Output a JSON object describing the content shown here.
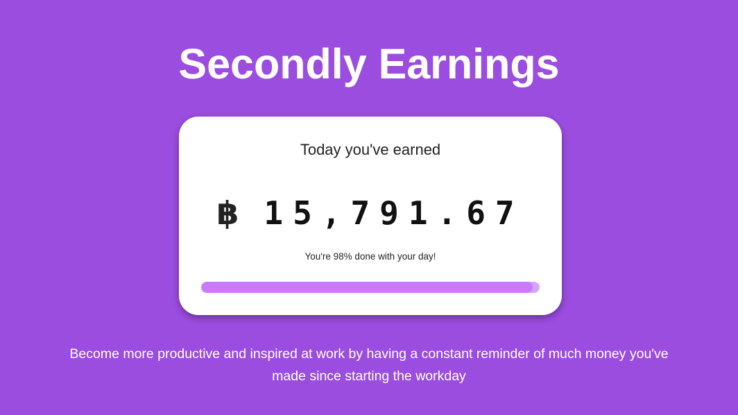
{
  "header": {
    "title": "Secondly Earnings"
  },
  "card": {
    "heading": "Today you've earned",
    "currency_symbol": "฿",
    "currency_icon": "baht-icon",
    "amount": "15,791.67",
    "progress_text": "You're 98% done with your day!",
    "progress_fraction": 0.98
  },
  "footer": {
    "tagline": "Become more productive and inspired at work by having a constant reminder of much money you've made since starting the workday"
  },
  "colors": {
    "background": "#9b4de0",
    "card": "#ffffff",
    "progress_fill": "#c97aff",
    "progress_track": "#d6a6ff"
  }
}
